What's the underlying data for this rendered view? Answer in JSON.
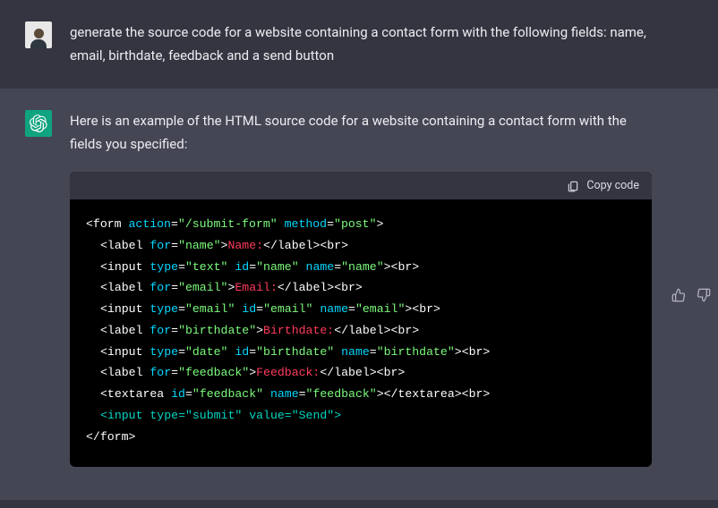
{
  "user": {
    "message": "generate the source code for a website containing a contact form with the following fields: name, email, birthdate, feedback and a send button"
  },
  "assistant": {
    "intro": "Here is an example of the HTML source code for a website containing a contact form with the fields you specified:",
    "copy_label": "Copy code",
    "code": {
      "form_open_a": "<form",
      "attr_action": " action",
      "val_action": "\"/submit-form\"",
      "attr_method": " method",
      "val_method": "\"post\"",
      "gt": ">",
      "label_open": "<label",
      "attr_for": " for",
      "val_name": "\"name\"",
      "txt_name": "Name:",
      "label_close": "</label>",
      "br": "<br>",
      "input_open": "<input",
      "attr_type": " type",
      "val_text": "\"text\"",
      "attr_id": " id",
      "attr_name": " name",
      "val_email": "\"email\"",
      "txt_email": "Email:",
      "val_type_email": "\"email\"",
      "val_birthdate": "\"birthdate\"",
      "txt_birthdate": "Birthdate:",
      "val_date": "\"date\"",
      "val_feedback": "\"feedback\"",
      "txt_feedback": "Feedback:",
      "textarea_open": "<textarea",
      "textarea_close_a": "></textarea>",
      "val_submit": "\"submit\"",
      "attr_value": " value",
      "val_send": "\"Send\"",
      "form_close": "</form>",
      "eq": "="
    }
  }
}
